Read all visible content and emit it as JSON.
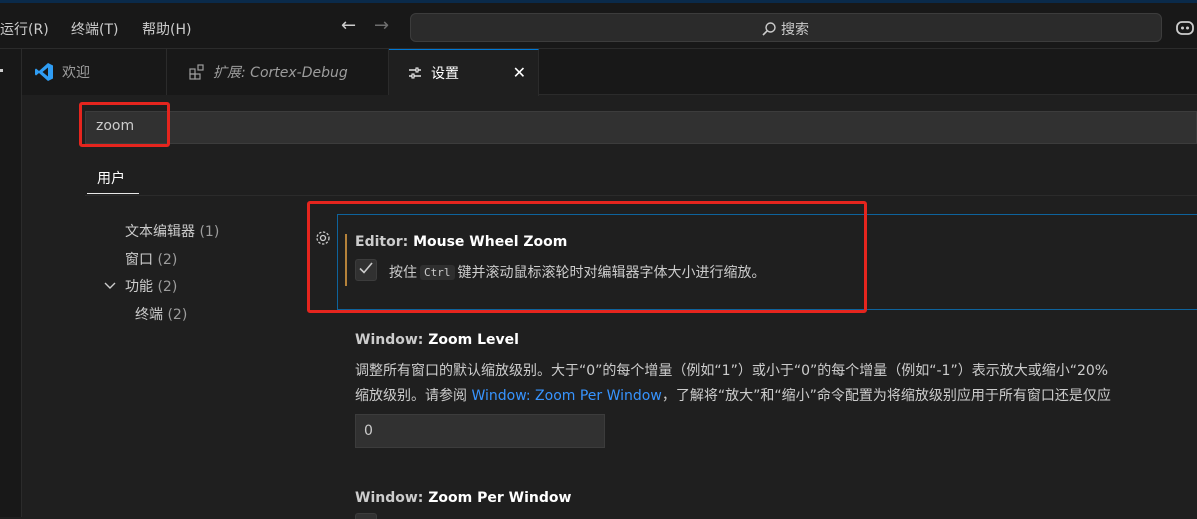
{
  "menu": [
    {
      "label": "运行(R)"
    },
    {
      "label": "终端(T)"
    },
    {
      "label": "帮助(H)"
    }
  ],
  "command_center": {
    "label": "搜索"
  },
  "tabs": [
    {
      "label": "欢迎",
      "icon": "vscode-logo-icon"
    },
    {
      "label": "扩展: Cortex-Debug",
      "icon": "extensions-icon"
    },
    {
      "label": "设置",
      "icon": "settings-sliders-icon",
      "close": "✕"
    }
  ],
  "settings": {
    "search_value": "zoom",
    "scope_tab": "用户",
    "toc": [
      {
        "label": "文本编辑器",
        "count": "(1)"
      },
      {
        "label": "窗口",
        "count": "(2)"
      },
      {
        "label": "功能",
        "count": "(2)"
      },
      {
        "label": "终端",
        "count": "(2)"
      }
    ],
    "items": [
      {
        "category": "Editor: ",
        "name": "Mouse Wheel Zoom",
        "desc_before": "按住",
        "kbd": "Ctrl",
        "desc_after": "键并滚动鼠标滚轮时对编辑器字体大小进行缩放。",
        "checked": true
      },
      {
        "category": "Window: ",
        "name": "Zoom Level",
        "line1": "调整所有窗口的默认缩放级别。大于“0”的每个增量（例如“1”）或小于“0”的每个增量（例如“-1”）表示放大或缩小“20%",
        "line2_before": "缩放级别。请参阅 ",
        "line2_link": "Window: Zoom Per Window",
        "line2_after": "，了解将“放大”和“缩小”命令配置为将缩放级别应用于所有窗口还是仅应",
        "value": "0"
      },
      {
        "category": "Window: ",
        "name": "Zoom Per Window"
      }
    ]
  },
  "colors": {
    "accent": "#0078d4",
    "highlight_box": "#e5251e",
    "link": "#3794ff",
    "modified_bar": "#b5823a"
  }
}
